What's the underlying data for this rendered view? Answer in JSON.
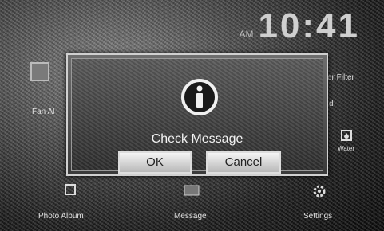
{
  "clock": {
    "ampm": "AM",
    "time": "10:41"
  },
  "background": {
    "left_top_label": "Fan Al",
    "right_top_label": "er Filter",
    "right_mid_label": "d",
    "water_label": "Water",
    "bottom_left_label": "Photo Album",
    "bottom_center_label": "Message",
    "bottom_right_label": "Settings"
  },
  "dialog": {
    "message": "Check Message",
    "ok_label": "OK",
    "cancel_label": "Cancel",
    "icon": "info-icon"
  }
}
